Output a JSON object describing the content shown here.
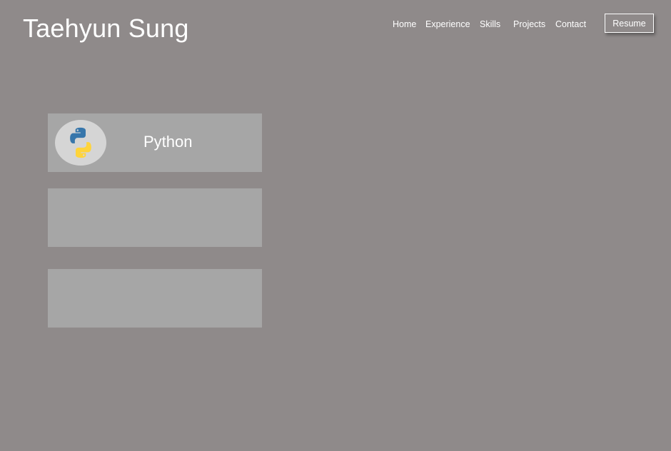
{
  "header": {
    "title": "Taehyun Sung"
  },
  "nav": {
    "items": [
      {
        "label": "Home"
      },
      {
        "label": "Experience"
      },
      {
        "label": "Skills"
      },
      {
        "label": "Projects"
      },
      {
        "label": "Contact"
      }
    ],
    "resume_label": "Resume"
  },
  "skills": {
    "cards": [
      {
        "name": "Python",
        "icon": "python-logo-icon"
      },
      {
        "name": null
      },
      {
        "name": null
      }
    ]
  },
  "colors": {
    "background": "#8f8a8a",
    "card": "#a6a6a6",
    "text": "#ffffff",
    "python_blue": "#3776ab",
    "python_yellow": "#ffd43b"
  }
}
